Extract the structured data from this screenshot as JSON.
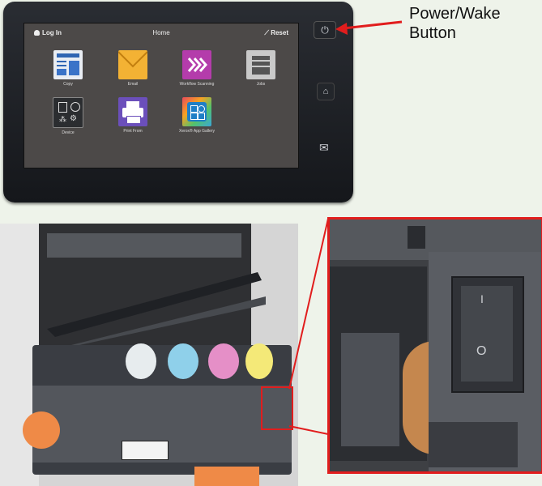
{
  "panel": {
    "login_label": "Log In",
    "home_title": "Home",
    "reset_label": "Reset",
    "apps": [
      {
        "label": "Copy",
        "icon": "copy-icon",
        "color": "#e9edf3"
      },
      {
        "label": "Email",
        "icon": "email-icon",
        "color": "#f3b234"
      },
      {
        "label": "Workflow Scanning",
        "icon": "workflow-scanning-icon",
        "color": "#b43cab"
      },
      {
        "label": "Jobs",
        "icon": "jobs-icon",
        "color": "#c9c9c9"
      },
      {
        "label": "Device",
        "icon": "device-icon",
        "color": "#2b2d30"
      },
      {
        "label": "Print From",
        "icon": "print-from-icon",
        "color": "#6b4fbb"
      },
      {
        "label": "Xerox® App Gallery",
        "icon": "app-gallery-icon",
        "color": "#3aa7d8"
      }
    ]
  },
  "annotation": {
    "line1": "Power/Wake",
    "line2": "Button",
    "color": "#e11d1d"
  },
  "switch": {
    "on_symbol": "I",
    "off_symbol": "O"
  }
}
